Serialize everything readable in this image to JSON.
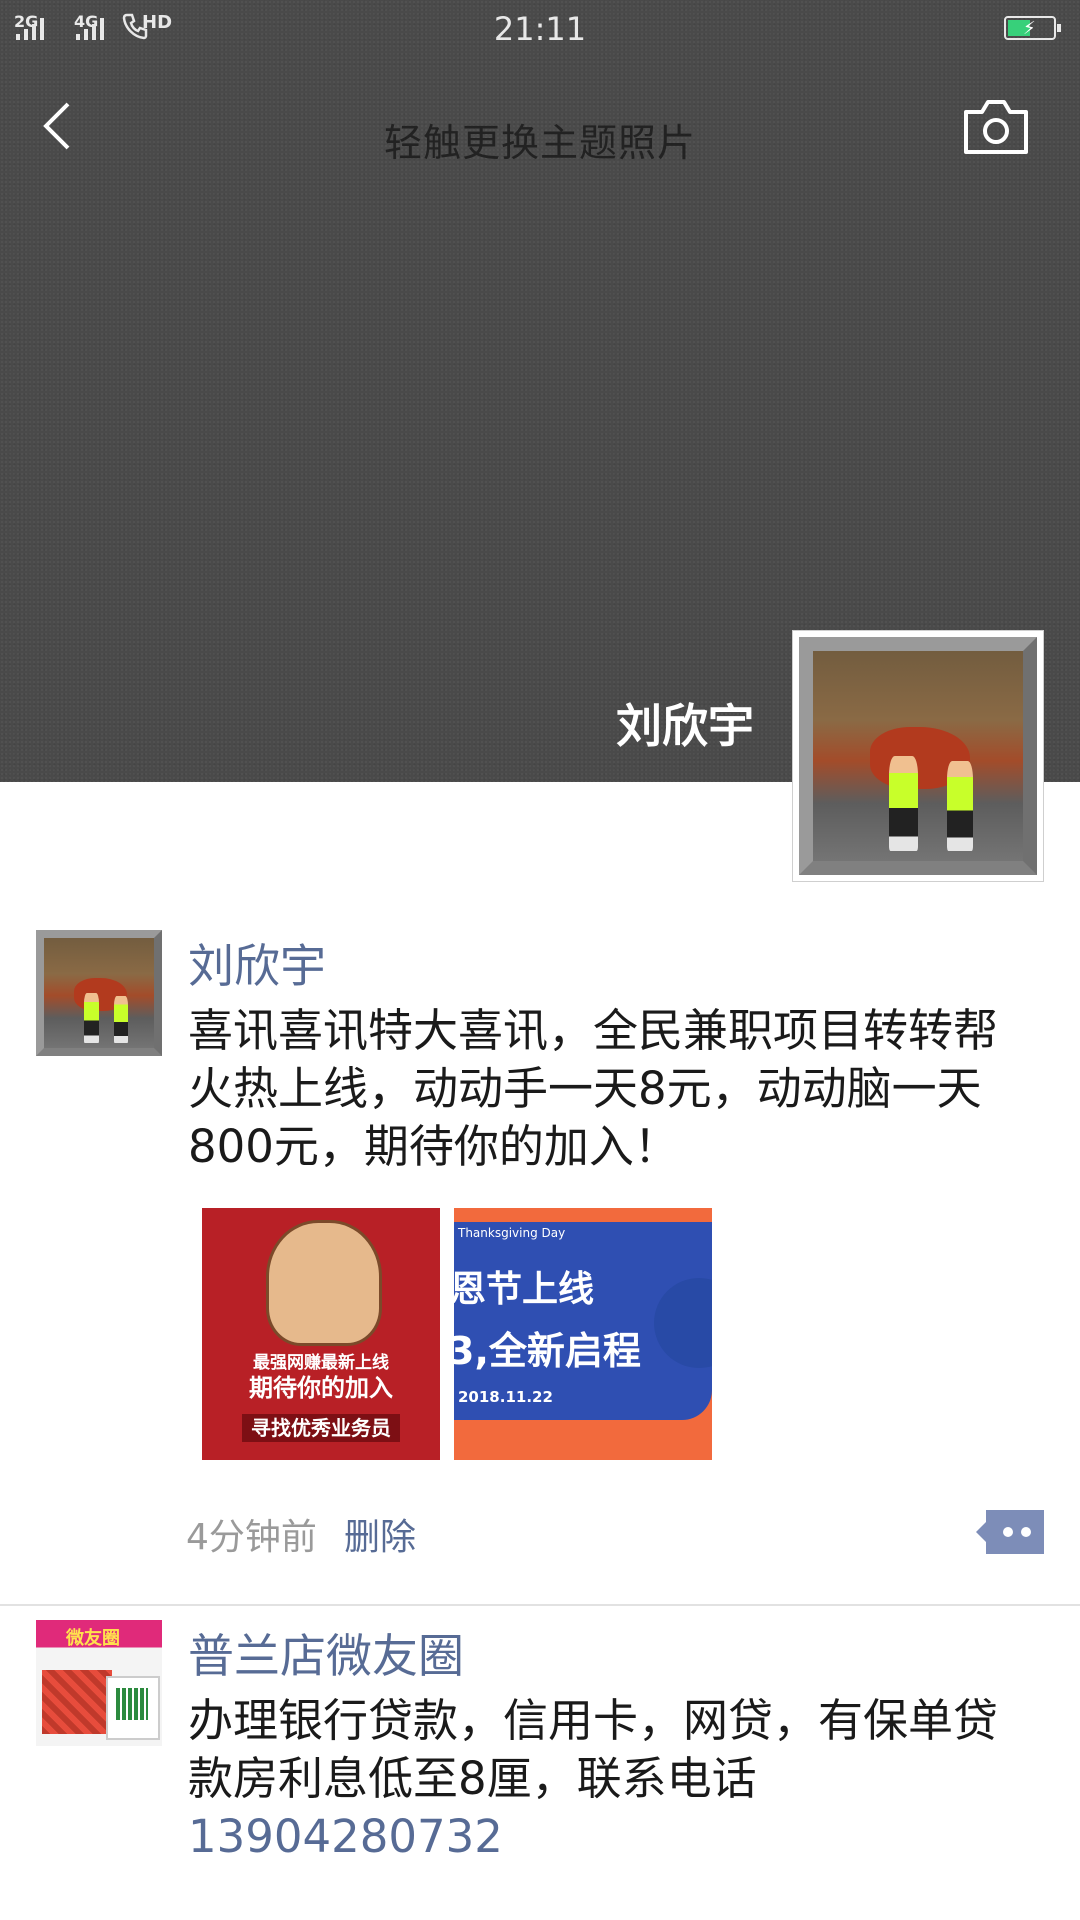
{
  "status_bar": {
    "signal1_label": "2G",
    "signal2_label": "4G",
    "hd_label": "HD",
    "time": "21:11",
    "battery_color": "#37d07a"
  },
  "header": {
    "title": "轻触更换主题照片",
    "back_icon": "chevron-left-icon",
    "camera_icon": "camera-icon"
  },
  "profile": {
    "name": "刘欣宇"
  },
  "posts": [
    {
      "author": "刘欣宇",
      "text": "喜讯喜讯特大喜讯，全民兼职项目转转帮火热上线，动动手一天8元，动动脑一天800元，期待你的加入！",
      "images": [
        {
          "line1": "最强网赚最新上线",
          "line2": "期待你的加入",
          "line3": "寻找优秀业务员"
        },
        {
          "small": "Thanksgiving Day",
          "line1": "恩节上线",
          "line2": "3,全新启程",
          "date": "2018.11.22"
        }
      ],
      "time": "4分钟前",
      "delete_label": "删除",
      "more_icon": "comment-more-icon"
    },
    {
      "author": "普兰店微友圈",
      "avatar_tag": "微友圈",
      "text": "办理银行贷款，信用卡，网贷，有保单贷款房利息低至8厘，联系电话",
      "phone": "13904280732"
    }
  ],
  "colors": {
    "link": "#576b95",
    "cover_bg": "#4a4a4a"
  }
}
